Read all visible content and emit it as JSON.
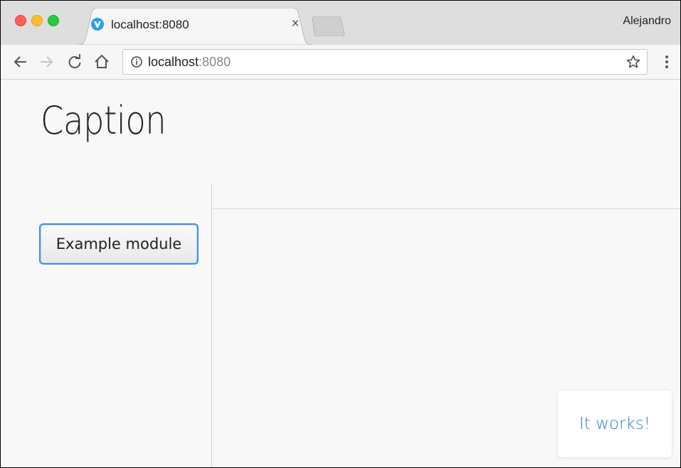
{
  "browser": {
    "tab": {
      "title": "localhost:8080",
      "close_glyph": "×",
      "favicon": "vaadin-logo-icon"
    },
    "profile_name": "Alejandro",
    "address_bar": {
      "host": "localhost",
      "port": ":8080"
    },
    "icons": {
      "back": "arrow-left-icon",
      "forward": "arrow-right-icon",
      "reload": "reload-icon",
      "home": "home-icon",
      "info": "info-icon",
      "bookmark": "star-icon",
      "menu": "kebab-menu-icon"
    },
    "colors": {
      "close": "#fe5f57",
      "minimize": "#febc2e",
      "maximize": "#28c840"
    }
  },
  "page": {
    "caption": "Caption",
    "menu": {
      "items": [
        {
          "label": "Example module"
        }
      ]
    },
    "notification": {
      "text": "It works!"
    },
    "colors": {
      "accent": "#3f8ee8",
      "notification_text": "#2b7fd4"
    }
  }
}
